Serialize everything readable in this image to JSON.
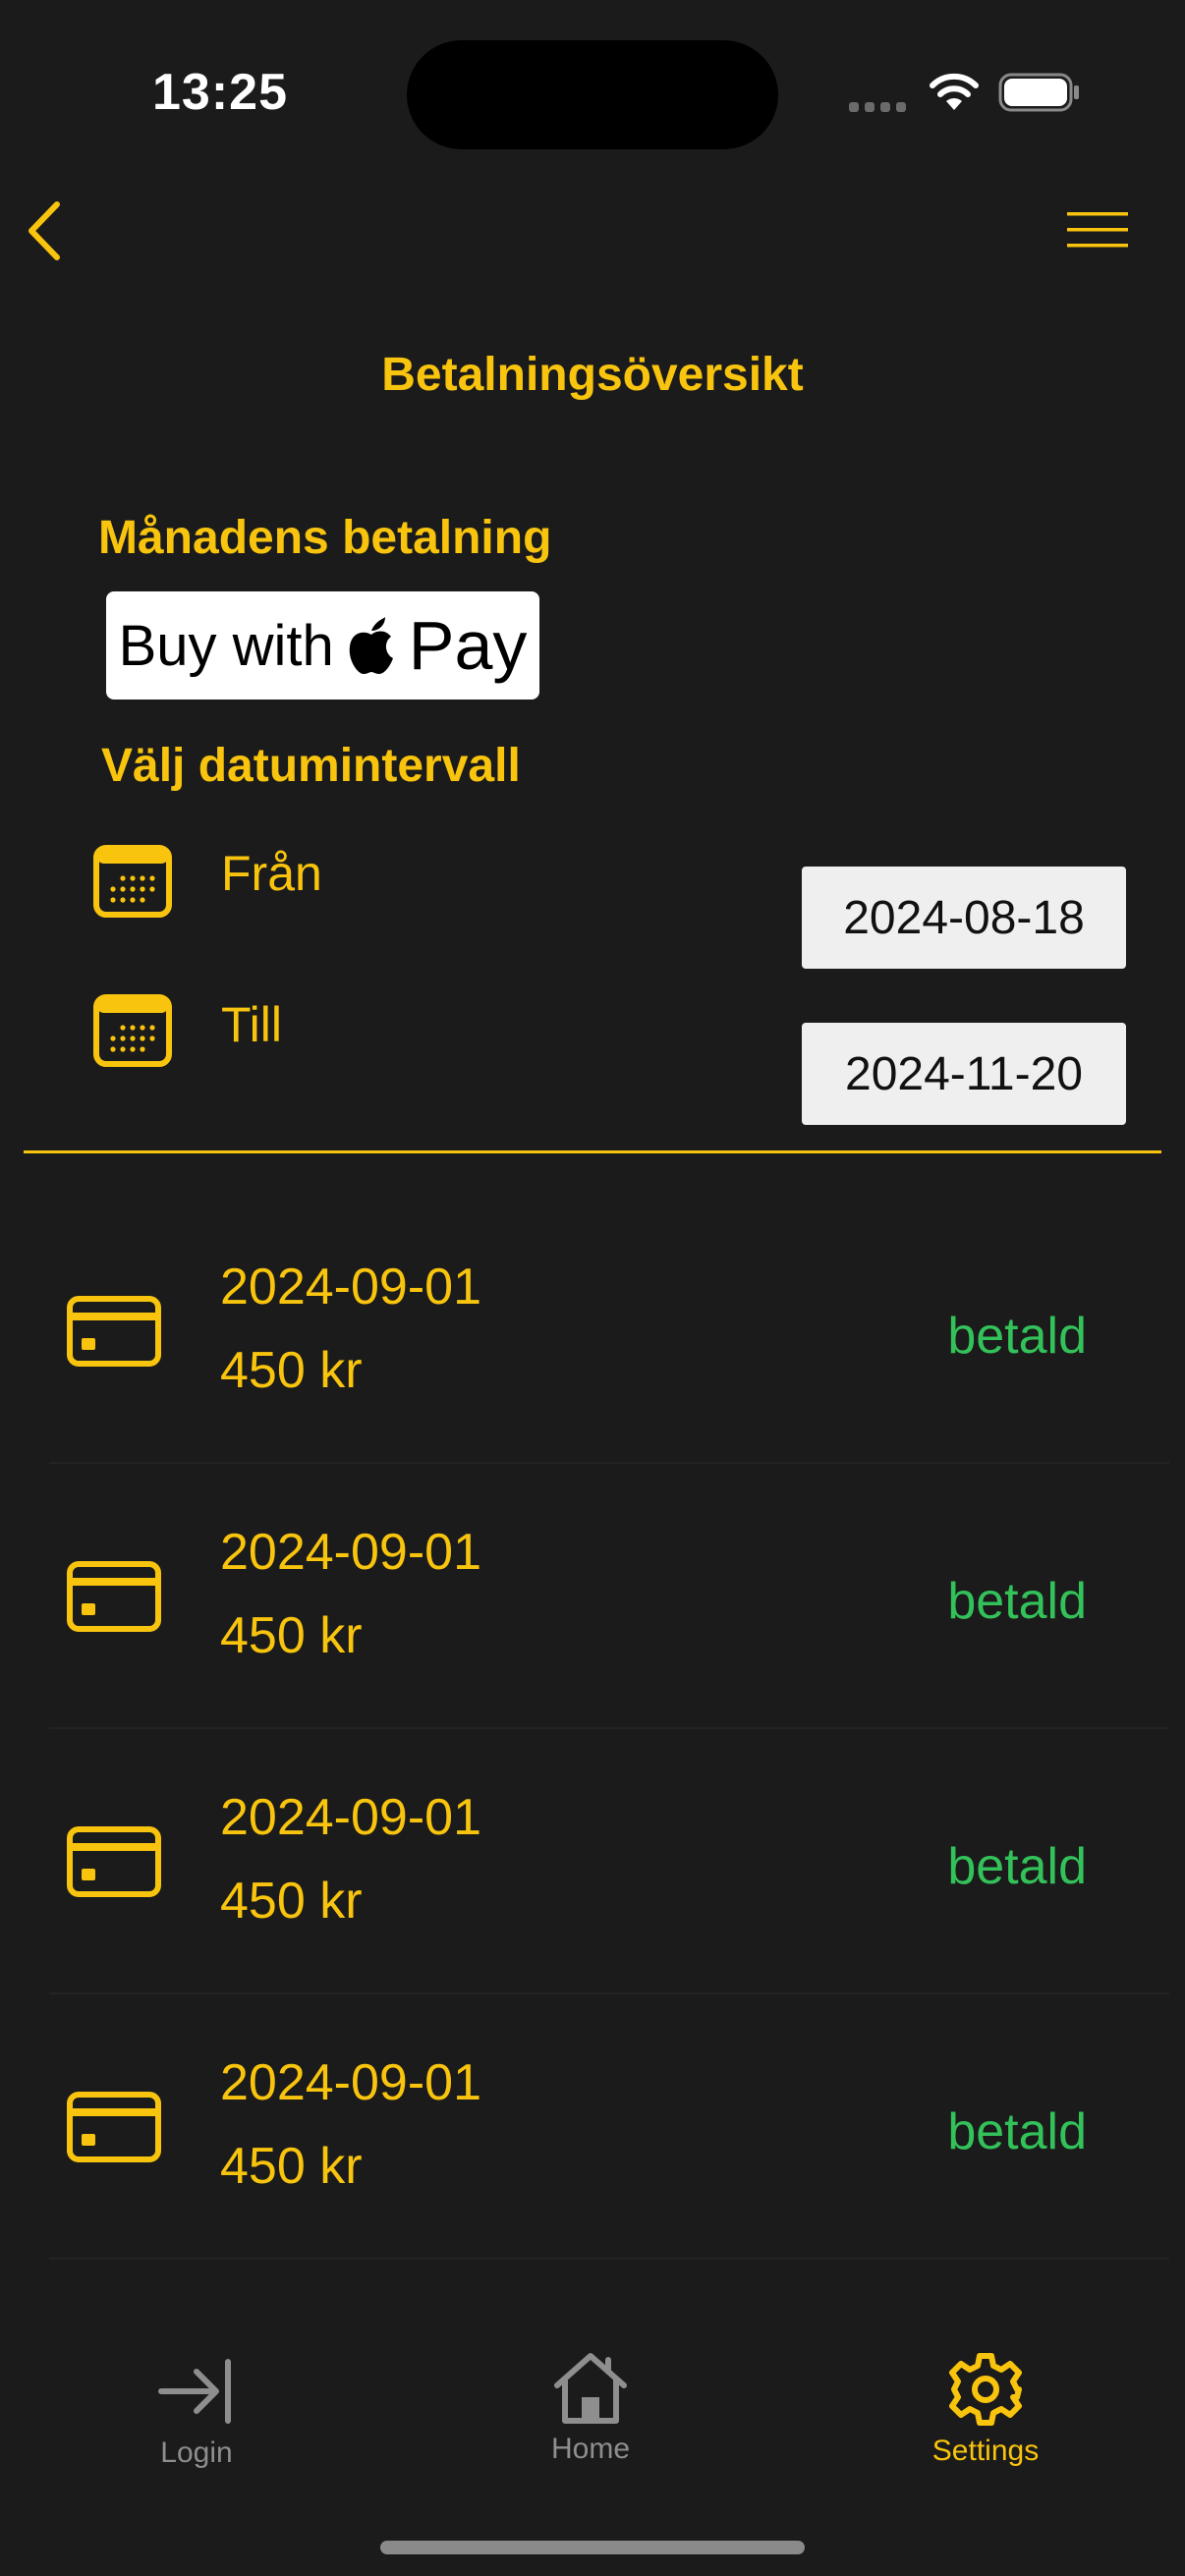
{
  "status_bar": {
    "time": "13:25"
  },
  "header": {
    "title": "Betalningsöversikt"
  },
  "payment": {
    "section_label": "Månadens betalning",
    "buy_text": "Buy with",
    "pay_text": "Pay"
  },
  "date_range": {
    "section_label": "Välj datumintervall",
    "from_label": "Från",
    "from_value": "2024-08-18",
    "to_label": "Till",
    "to_value": "2024-11-20"
  },
  "payments": [
    {
      "date": "2024-09-01",
      "amount": "450 kr",
      "status": "betald"
    },
    {
      "date": "2024-09-01",
      "amount": "450 kr",
      "status": "betald"
    },
    {
      "date": "2024-09-01",
      "amount": "450 kr",
      "status": "betald"
    },
    {
      "date": "2024-09-01",
      "amount": "450 kr",
      "status": "betald"
    }
  ],
  "tabs": [
    {
      "label": "Login",
      "icon": "login-arrow-icon",
      "active": false
    },
    {
      "label": "Home",
      "icon": "home-icon",
      "active": false
    },
    {
      "label": "Settings",
      "icon": "gear-icon",
      "active": true
    }
  ],
  "colors": {
    "accent": "#f8c40e",
    "paid": "#33c25a",
    "background": "#1b1b1b",
    "inactive_tab": "#8e8e8e"
  }
}
